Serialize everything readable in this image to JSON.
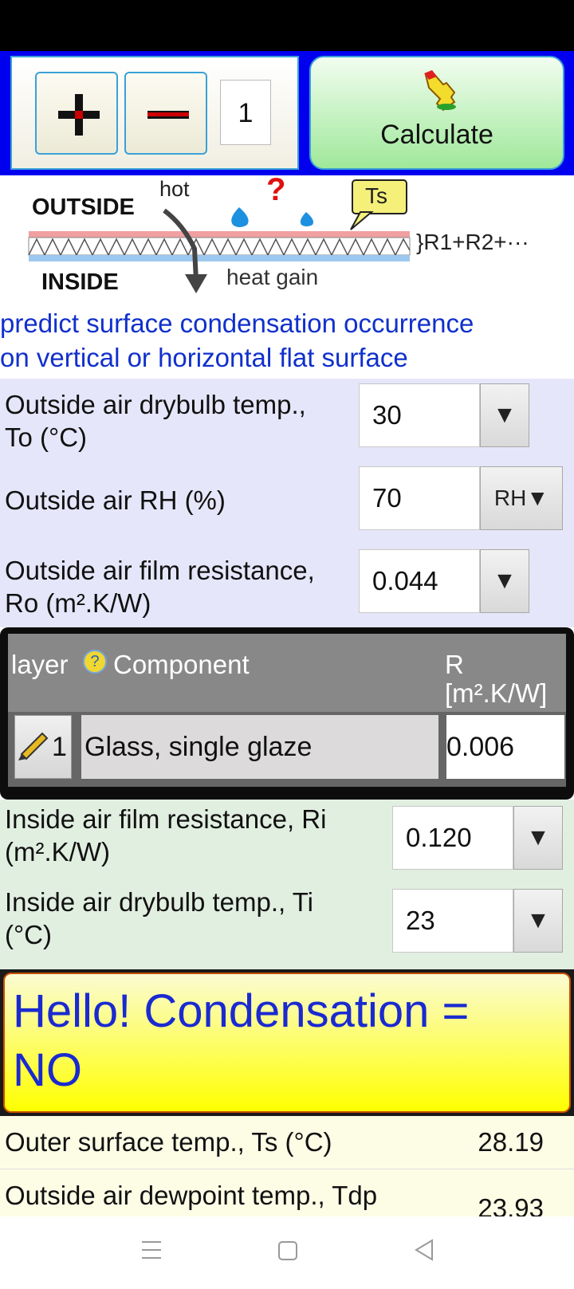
{
  "toolbar": {
    "plus_button": "+",
    "minus_button": "−",
    "layer_count": "1",
    "calculate_label": "Calculate"
  },
  "diagram": {
    "outside_label": "OUTSIDE",
    "inside_label": "INSIDE",
    "hot_label": "hot",
    "question_mark": "?",
    "ts_label": "Ts",
    "resistance_label": "}R1+R2+···",
    "heat_gain_label": "heat gain"
  },
  "description": {
    "line1": "predict surface condensation occurrence",
    "line2": "on vertical or horizontal flat surface"
  },
  "outside": {
    "drybulb_label_1": "Outside air drybulb temp.,",
    "drybulb_label_2": "To (°C)",
    "drybulb_value": "30",
    "rh_label": "Outside air RH (%)",
    "rh_value": "70",
    "rh_dropdown": "RH",
    "film_label_1": "Outside air film resistance,",
    "film_label_2": "Ro (m².K/W)",
    "film_value": "0.044"
  },
  "layers": {
    "header_layer": "layer",
    "header_component": "Component",
    "header_r_1": "R",
    "header_r_2": "[m².K/W]",
    "rows": [
      {
        "index": "1",
        "component": "Glass, single glaze",
        "r": "0.006"
      }
    ]
  },
  "inside": {
    "film_label_1": "Inside air film resistance, Ri",
    "film_label_2": "(m².K/W)",
    "film_value": "0.120",
    "drybulb_label_1": "Inside air drybulb temp., Ti",
    "drybulb_label_2": "(°C)",
    "drybulb_value": "23"
  },
  "result": {
    "line1": "Hello! Condensation =",
    "line2": "NO"
  },
  "outputs": [
    {
      "label": "Outer surface temp., Ts (°C)",
      "value": "28.19"
    },
    {
      "label": "Outside air dewpoint temp., Tdp",
      "value": "23.93"
    }
  ],
  "colors": {
    "accent_blue": "#0000ee",
    "description_blue": "#1030cc",
    "result_yellow": "#ffff00",
    "calc_green": "#9fe89a"
  }
}
